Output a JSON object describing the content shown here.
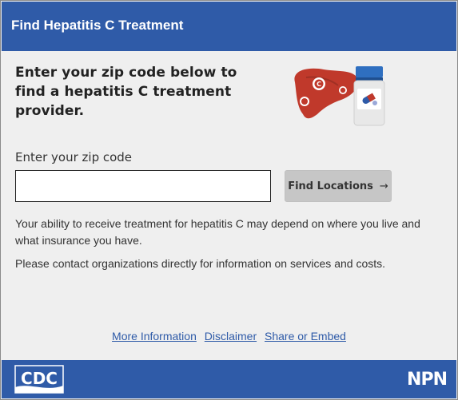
{
  "header": {
    "title": "Find Hepatitis C Treatment"
  },
  "intro": {
    "text": "Enter your zip code below to find a hepatitis C treatment provider."
  },
  "illustration": {
    "icon": "liver-and-medication-illustration"
  },
  "search": {
    "label": "Enter your zip code",
    "value": "",
    "placeholder": "",
    "button_label": "Find Locations",
    "button_icon": "arrow-right-icon"
  },
  "info": {
    "paragraph1": "Your ability to receive treatment for hepatitis C may depend on where you live and what insurance you have.",
    "paragraph2": "Please contact organizations directly for information on services and costs."
  },
  "footer": {
    "links": [
      "More Information",
      "Disclaimer",
      "Share or Embed"
    ],
    "logo_left": "CDC",
    "logo_right": "NPN"
  },
  "colors": {
    "brand_blue": "#2f5ba8",
    "background": "#efefef",
    "button_gray": "#c6c6c6",
    "liver_red": "#c0392b"
  }
}
